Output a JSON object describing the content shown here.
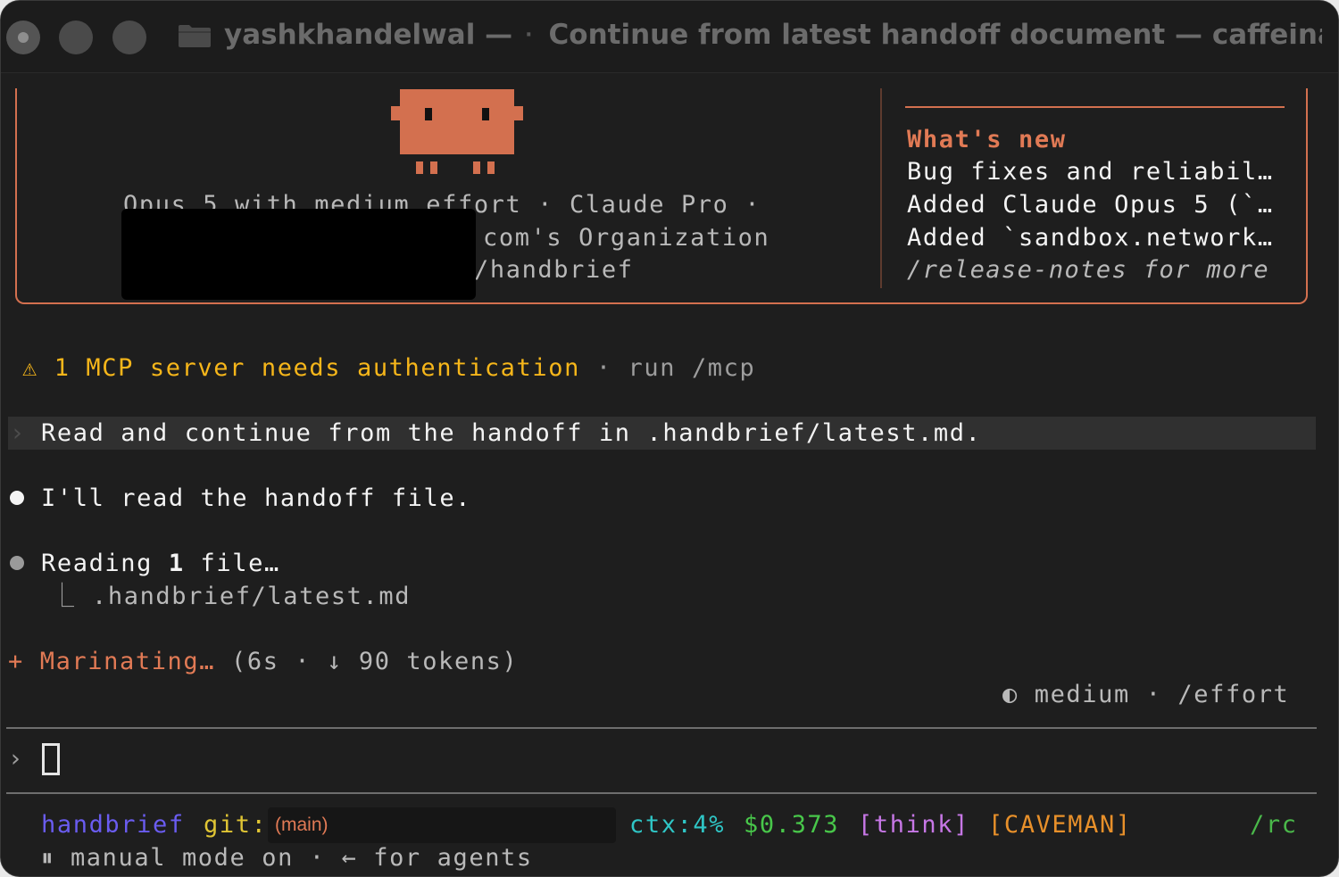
{
  "window": {
    "user": "yashkhandelwal",
    "title": "Continue from latest handoff document — caffeinat…"
  },
  "banner": {
    "model_line": "Opus 5 with medium effort · Claude Pro ·",
    "org_line": "com's Organization",
    "path_line": "/handbrief",
    "whats_new": {
      "heading": "What's new",
      "items": [
        "Bug fixes and reliabil…",
        "Added Claude Opus 5 (`…",
        "Added `sandbox.network…"
      ],
      "footer": "/release-notes for more"
    },
    "colors": {
      "accent": "#d3704f"
    }
  },
  "warning": {
    "icon": "⚠",
    "text": "1 MCP server needs authentication",
    "hint": "· run /mcp"
  },
  "transcript": {
    "user_prompt": "Read and continue from the handoff in .handbrief/latest.md.",
    "assistant_msg": "I'll read the handoff file.",
    "tool": {
      "label_prefix": "Reading ",
      "count": "1",
      "label_suffix": " file…",
      "file": ".handbrief/latest.md"
    },
    "spinner": {
      "glyph": "+",
      "verb": "Marinating…",
      "detail": "(6s · ↓ 90 tokens)"
    },
    "effort": {
      "icon": "◐",
      "text": "medium · /effort"
    }
  },
  "input": {
    "prompt_glyph": "›"
  },
  "statusbar": {
    "project": "handbrief",
    "git_label": "git:",
    "branch": "(main)",
    "ctx": "ctx:4%",
    "cost": "$0.373",
    "think": "[think]",
    "caveman": "[CAVEMAN]",
    "rc": "/rc",
    "mode_line": "⏸ manual mode on · ← for agents",
    "colors": {
      "project": "#6a5cf0",
      "git": "#e0c534",
      "branch": "#e17a55",
      "ctx": "#2fc6c6",
      "cost": "#48c74a",
      "think": "#c777e6",
      "caveman": "#e8902a",
      "rc": "#4ab84a"
    }
  }
}
